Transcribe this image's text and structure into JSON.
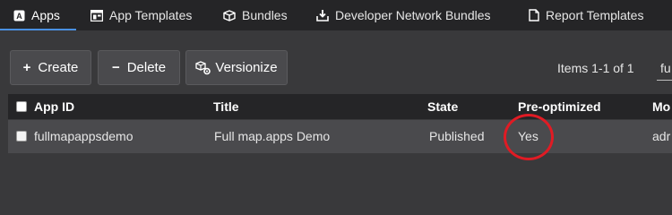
{
  "tabs": [
    {
      "label": "Apps",
      "icon": "apps-icon",
      "active": true
    },
    {
      "label": "App Templates",
      "icon": "app-templates-icon",
      "active": false
    },
    {
      "label": "Bundles",
      "icon": "bundles-icon",
      "active": false
    },
    {
      "label": "Developer Network Bundles",
      "icon": "download-icon",
      "active": false
    },
    {
      "label": "Report Templates",
      "icon": "document-icon",
      "active": false
    }
  ],
  "toolbar": {
    "create_label": "Create",
    "create_symbol": "+",
    "delete_label": "Delete",
    "delete_symbol": "−",
    "versionize_label": "Versionize",
    "versionize_icon": "versionize-icon",
    "items_count": "Items 1-1 of 1",
    "filter_value": "fu"
  },
  "table": {
    "columns": [
      "App ID",
      "Title",
      "State",
      "Pre-optimized",
      "Mo"
    ],
    "rows": [
      {
        "app_id": "fullmapappsdemo",
        "title": "Full map.apps Demo",
        "state": "Published",
        "pre_optimized": "Yes",
        "mo": "adr"
      }
    ]
  },
  "colors": {
    "accent": "#4a90e2",
    "annotation": "#e01b24",
    "background": "#39393b",
    "header_bg": "#252527",
    "button_bg": "#4a4a4d"
  }
}
